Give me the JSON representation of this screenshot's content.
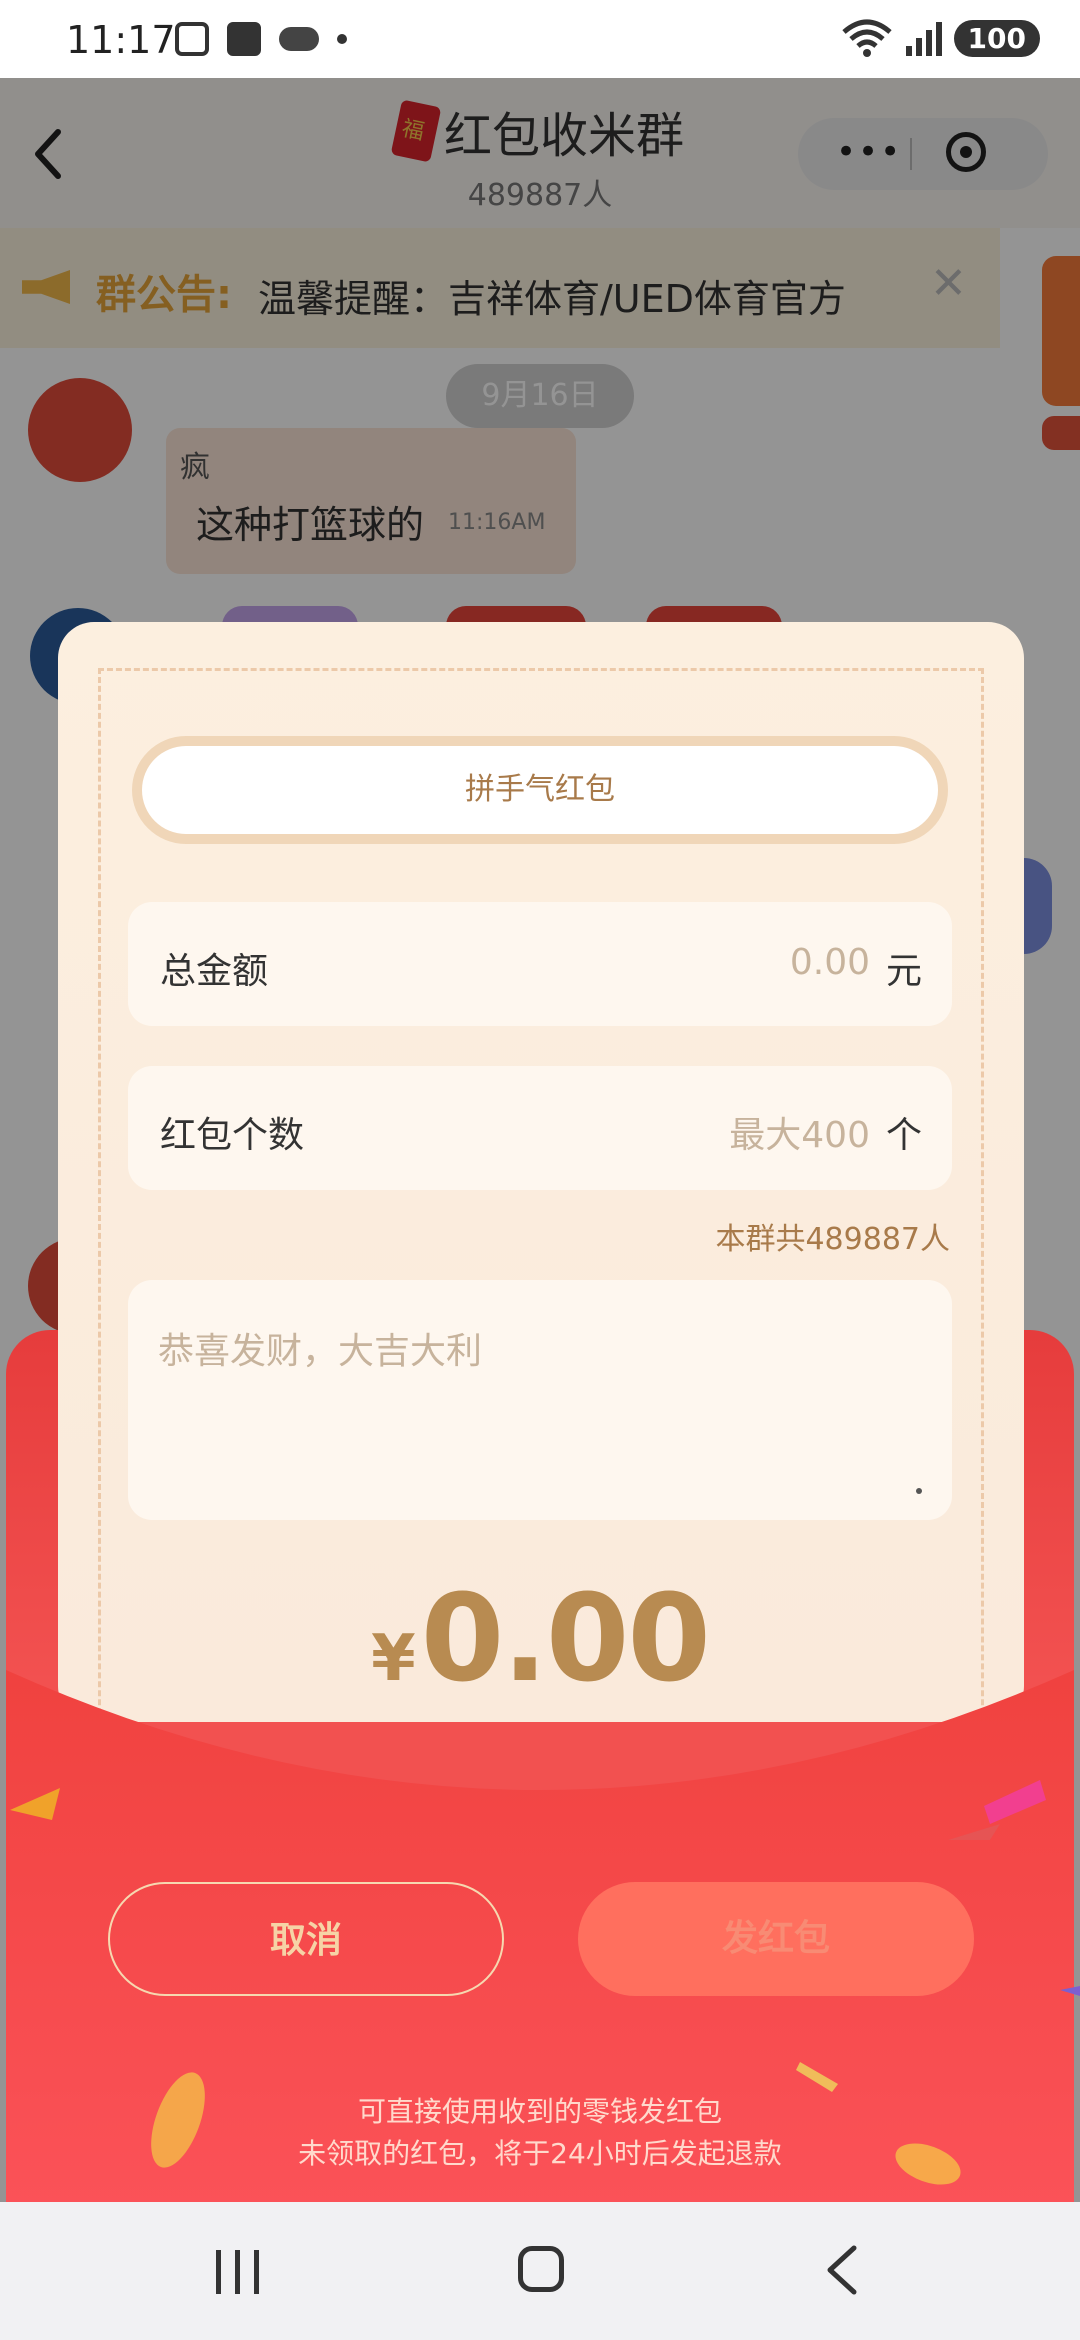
{
  "status_bar": {
    "time": "11:17",
    "battery": "100",
    "wifi_label": "5"
  },
  "chat": {
    "title": "红包收米群",
    "member_count": "489887人",
    "notice_label": "群公告:",
    "notice_text": "温馨提醒：吉祥体育/UED体育官方",
    "date": "9月16日",
    "message_name": "疯",
    "message_text": "这种打篮球的",
    "message_time": "11:16AM"
  },
  "red_packet": {
    "type_label": "拼手气红包",
    "amount_label": "总金额",
    "amount_placeholder": "0.00",
    "amount_unit": "元",
    "count_label": "红包个数",
    "count_placeholder": "最大400",
    "count_unit": "个",
    "members_hint": "本群共489887人",
    "message_placeholder": "恭喜发财，大吉大利",
    "currency_symbol": "¥",
    "total_amount": "0.00",
    "cancel_label": "取消",
    "send_label": "发红包",
    "note_line1": "可直接使用收到的零钱发红包",
    "note_line2": "未领取的红包，将于24小时后发起退款"
  },
  "colors": {
    "envelope_red": "#f24a4a",
    "card_cream": "#fcefdf",
    "gold_text": "#b88b51",
    "send_button": "#ff6f5e"
  }
}
